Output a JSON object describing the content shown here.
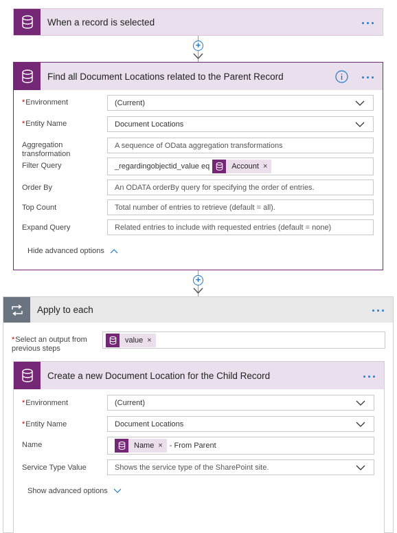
{
  "trigger": {
    "title": "When a record is selected"
  },
  "find_action": {
    "title": "Find all Document Locations related to the Parent Record",
    "fields": {
      "environment": {
        "label": "Environment",
        "value": "(Current)"
      },
      "entity_name": {
        "label": "Entity Name",
        "value": "Document Locations"
      },
      "aggregation": {
        "label": "Aggregation transformation",
        "placeholder": "A sequence of OData aggregation transformations"
      },
      "filter_query": {
        "label": "Filter Query",
        "text": "_regardingobjectid_value eq",
        "token": "Account"
      },
      "order_by": {
        "label": "Order By",
        "placeholder": "An ODATA orderBy query for specifying the order of entries."
      },
      "top_count": {
        "label": "Top Count",
        "placeholder": "Total number of entries to retrieve (default = all)."
      },
      "expand_query": {
        "label": "Expand Query",
        "placeholder": "Related entries to include with requested entries (default = none)"
      }
    },
    "advanced_toggle": "Hide advanced options"
  },
  "apply_each": {
    "title": "Apply to each",
    "select_output_label": "Select an output from previous steps",
    "select_output_token": "value",
    "inner_action": {
      "title": "Create a new Document Location for the Child Record",
      "fields": {
        "environment": {
          "label": "Environment",
          "value": "(Current)"
        },
        "entity_name": {
          "label": "Entity Name",
          "value": "Document Locations"
        },
        "name": {
          "label": "Name",
          "token": "Name",
          "suffix": "- From Parent"
        },
        "service_type": {
          "label": "Service Type Value",
          "placeholder": "Shows the service type of the SharePoint site."
        }
      },
      "advanced_toggle": "Show advanced options"
    }
  },
  "colors": {
    "accent_purple": "#742774",
    "header_purple_light": "#eadfec",
    "link_blue": "#1f78c8",
    "apply_header": "#e8e8e8",
    "apply_icon": "#6a7380"
  },
  "icons": [
    "database-icon",
    "info-icon",
    "ellipsis-icon",
    "plus-icon",
    "chevron-down-icon",
    "chevron-up-icon",
    "loop-icon",
    "close-icon",
    "arrow-down-icon"
  ]
}
